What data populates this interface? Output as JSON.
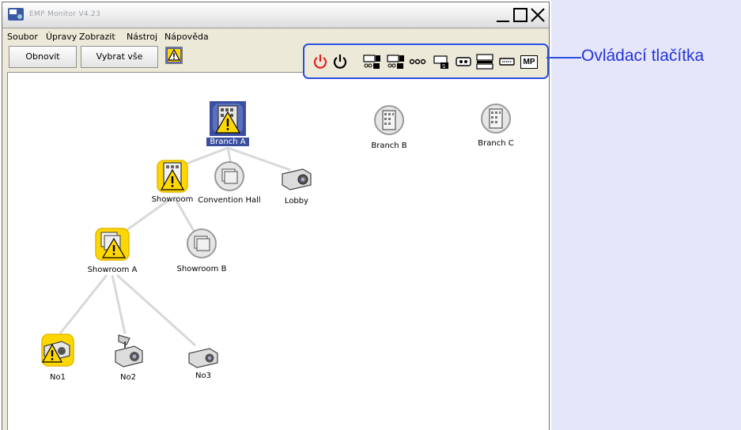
{
  "window": {
    "title": "EMP Monitor V4.23"
  },
  "menu": {
    "items": [
      "Soubor",
      "Úpravy",
      "Zobrazit",
      "Nástroj",
      "Nápověda"
    ]
  },
  "toolbar": {
    "refresh_label": "Obnovit",
    "select_all_label": "Vybrat vše"
  },
  "tree": {
    "nodes": {
      "branch_a": "Branch A",
      "branch_b": "Branch B",
      "branch_c": "Branch C",
      "showroom": "Showroom",
      "convention_hall": "Convention Hall",
      "lobby": "Lobby",
      "showroom_a": "Showroom A",
      "showroom_b": "Showroom B",
      "no1": "No1",
      "no2": "No2",
      "no3": "No3"
    }
  },
  "controls": {
    "mp_label": "MP",
    "icons": [
      "power-on-icon",
      "power-off-icon",
      "source-computer1-icon",
      "source-computer2-icon",
      "source-video-icon",
      "source-svideo-icon",
      "source-component-icon",
      "source-easymp-icon",
      "source-dvi-icon",
      "mp-icon"
    ]
  },
  "callout": {
    "label": "Ovládací tlačítka"
  },
  "colors": {
    "accent": "#2a4fe0",
    "callout_text": "#2233dd",
    "right_panel": "#e6e6fa",
    "warning_bg": "#ffd700",
    "selection": "#3a4fa0",
    "power_on": "#e02020"
  }
}
